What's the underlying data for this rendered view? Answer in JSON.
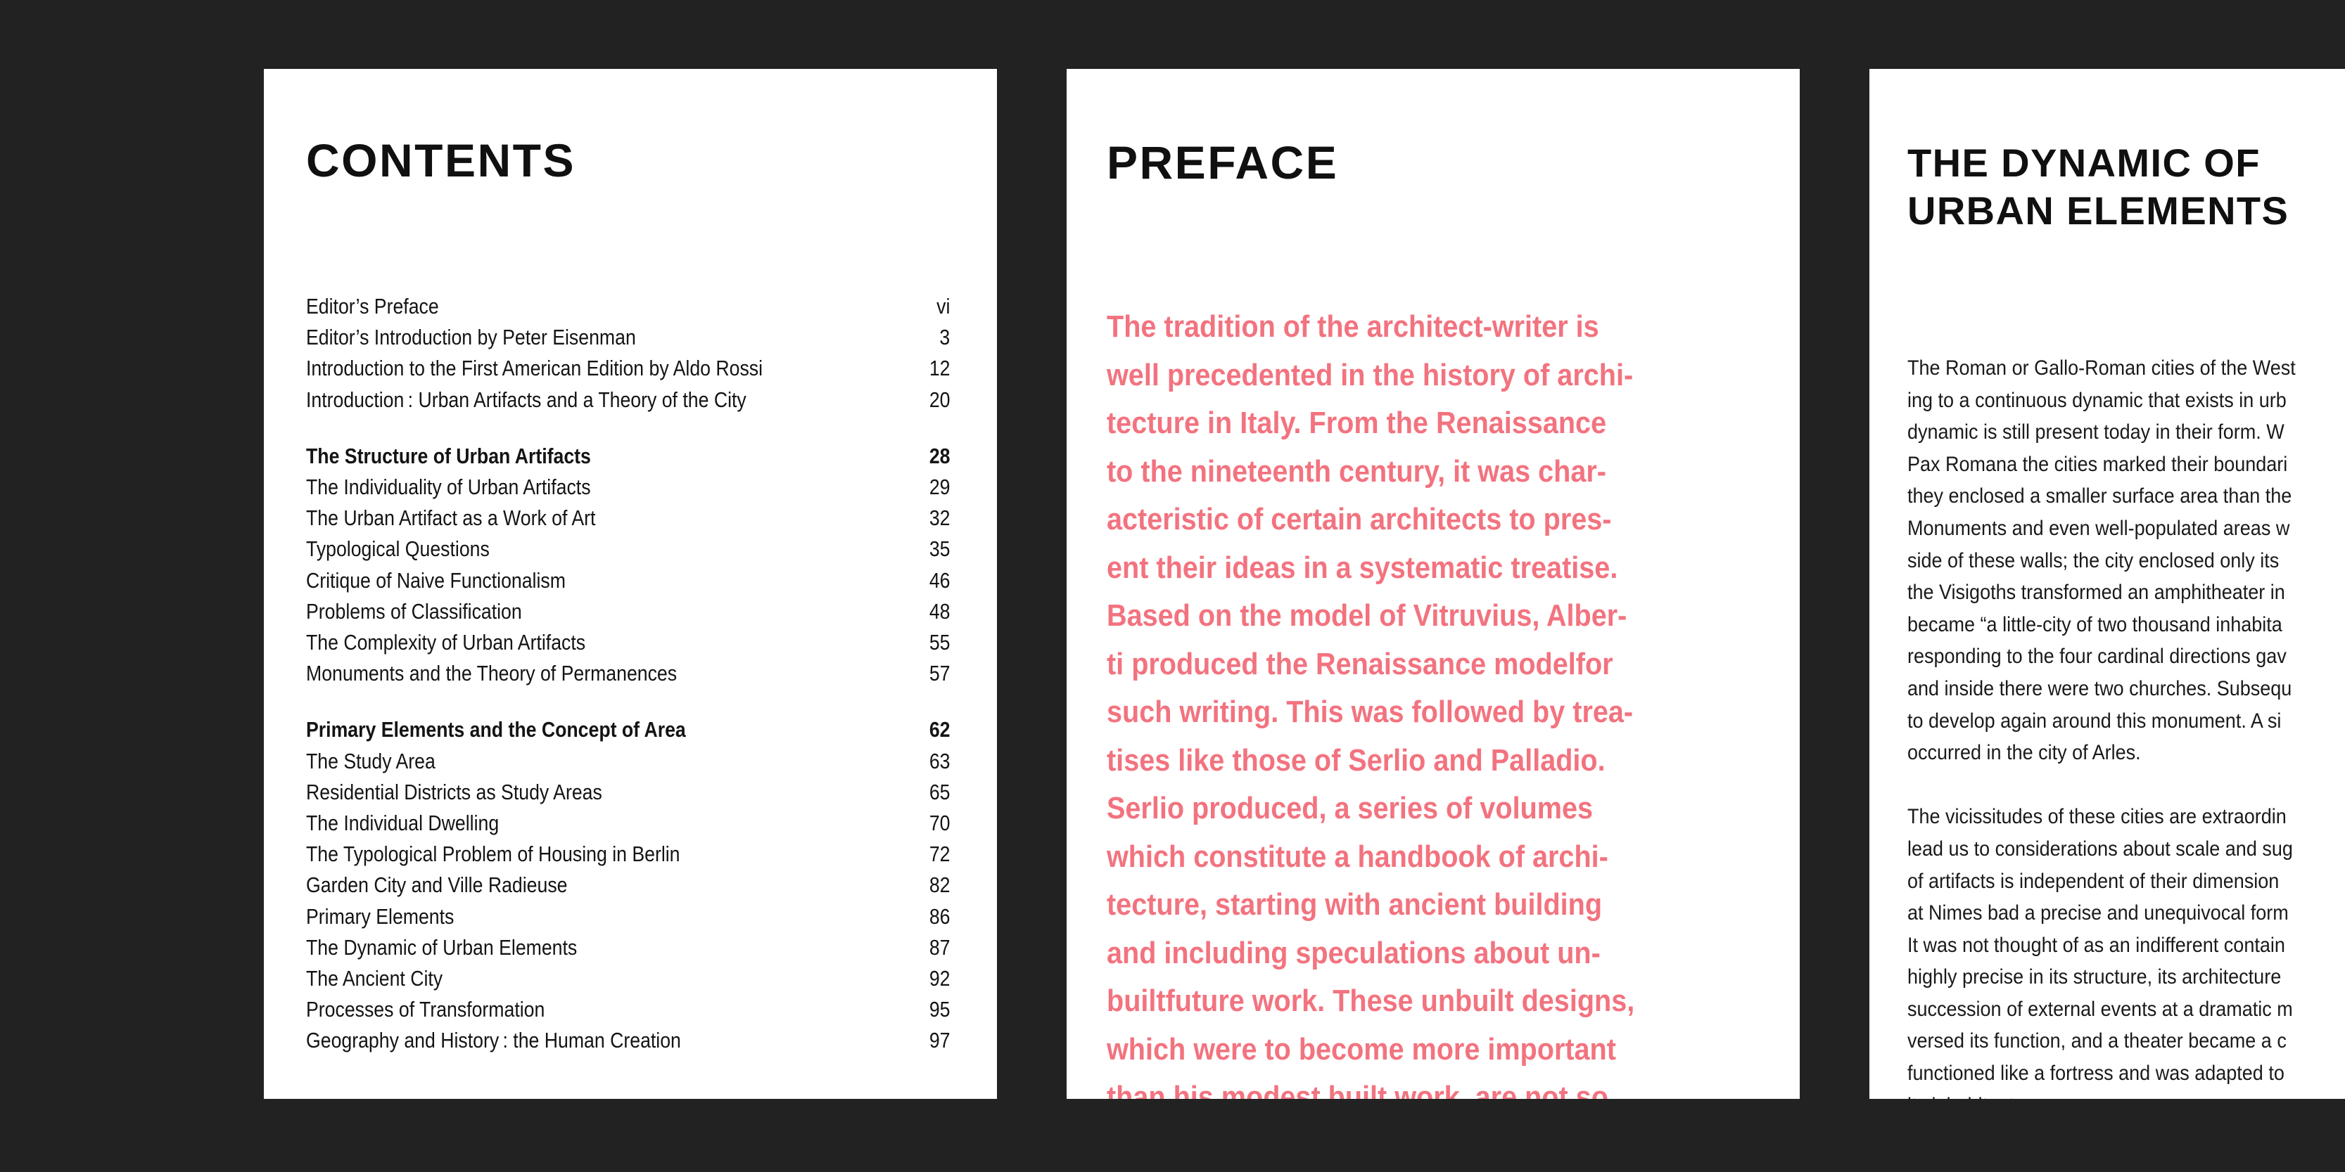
{
  "background_color": "#222222",
  "page_color": "#ffffff",
  "accent_color": "#f2737f",
  "text_color": "#141414",
  "pages": {
    "contents": {
      "title": "CONTENTS",
      "groups": [
        {
          "rows": [
            {
              "title": "Editor’s Preface",
              "page": "vi",
              "bold": false
            },
            {
              "title": "Editor’s Introduction by Peter Eisenman",
              "page": "3",
              "bold": false
            },
            {
              "title": "Introduction to the First American Edition by Aldo Rossi",
              "page": "12",
              "bold": false
            },
            {
              "title": "Introduction :  Urban Artifacts and a Theory of the City",
              "page": "20",
              "bold": false
            }
          ]
        },
        {
          "rows": [
            {
              "title": "The Structure of Urban Artifacts",
              "page": "28",
              "bold": true
            },
            {
              "title": "The Individuality of Urban Artifacts",
              "page": "29",
              "bold": false
            },
            {
              "title": "The Urban Artifact as a Work of Art",
              "page": "32",
              "bold": false
            },
            {
              "title": "Typological Questions",
              "page": "35",
              "bold": false
            },
            {
              "title": "Critique of Naive Functionalism",
              "page": "46",
              "bold": false
            },
            {
              "title": "Problems of Classification",
              "page": "48",
              "bold": false
            },
            {
              "title": "The Complexity of Urban Artifacts",
              "page": "55",
              "bold": false
            },
            {
              "title": "Monuments and the Theory of Permanences",
              "page": "57",
              "bold": false
            }
          ]
        },
        {
          "rows": [
            {
              "title": "Primary Elements and the Concept of Area",
              "page": "62",
              "bold": true
            },
            {
              "title": "The Study Area",
              "page": "63",
              "bold": false
            },
            {
              "title": "Residential Districts as Study Areas",
              "page": "65",
              "bold": false
            },
            {
              "title": "The Individual Dwelling",
              "page": "70",
              "bold": false
            },
            {
              "title": "The Typological Problem of Housing in Berlin",
              "page": "72",
              "bold": false
            },
            {
              "title": "Garden City and Ville Radieuse",
              "page": "82",
              "bold": false
            },
            {
              "title": "Primary Elements",
              "page": "86",
              "bold": false
            },
            {
              "title": "The Dynamic of Urban Elements",
              "page": "87",
              "bold": false
            },
            {
              "title": "The Ancient City",
              "page": "92",
              "bold": false
            },
            {
              "title": "Processes of Transformation",
              "page": "95",
              "bold": false
            },
            {
              "title": "Geography and History :  the Human Creation",
              "page": "97",
              "bold": false
            }
          ]
        }
      ]
    },
    "preface": {
      "title": "PREFACE",
      "body_lines": [
        "The tradition of the architect-writer is",
        "well precedented in the history of archi-",
        "tecture in Italy. From the Renaissance",
        "to the nineteenth century, it was char-",
        "acteristic of certain architects to pres-",
        "ent their ideas in a systematic treatise.",
        "Based on the model of Vitruvius, Alber-",
        "ti produced the Renaissance modelfor",
        "such writing. This was followed by trea-",
        "tises like those of Serlio and Palladio.",
        "Serlio produced, a series of volumes",
        "which constitute a handbook of archi-",
        "tecture, starting with ancient building",
        "and including speculations about un-",
        "builtfuture work. These unbuilt designs,",
        "which were to become more important",
        "than his modest built work, are not so"
      ]
    },
    "dynamic": {
      "title_lines": [
        "THE DYNAMIC OF",
        "URBAN ELEMENTS"
      ],
      "body_lines": [
        "The Roman or Gallo-Roman cities of the West",
        "ing to a continuous dynamic that exists in urb",
        "dynamic is still present today in their form. W",
        "Pax Romana the cities marked their boundari",
        "they enclosed a smaller surface area than the",
        "Monuments and even well-populated areas w",
        "side of these walls; the city enclosed only its",
        "the Visigoths transformed an amphitheater in",
        "became “a little-city of two thousand inhabita",
        "responding to the four cardinal directions gav",
        "and inside there were two churches. Subsequ",
        "to develop again around this monument. A si",
        "occurred in the city of Arles.",
        "",
        "The vicissitudes of these cities are extraordin",
        "lead us to considerations about scale and sug",
        "of artifacts is independent of their dimension",
        "at Nimes bad a precise and unequivocal form",
        "It was not thought of as an indifferent contain",
        "highly precise in its structure, its architecture",
        "succession of external events at a dramatic m",
        "versed its function, and a theater became a c",
        "functioned like a fortress and was adapted to",
        "its inhabitants."
      ]
    }
  }
}
